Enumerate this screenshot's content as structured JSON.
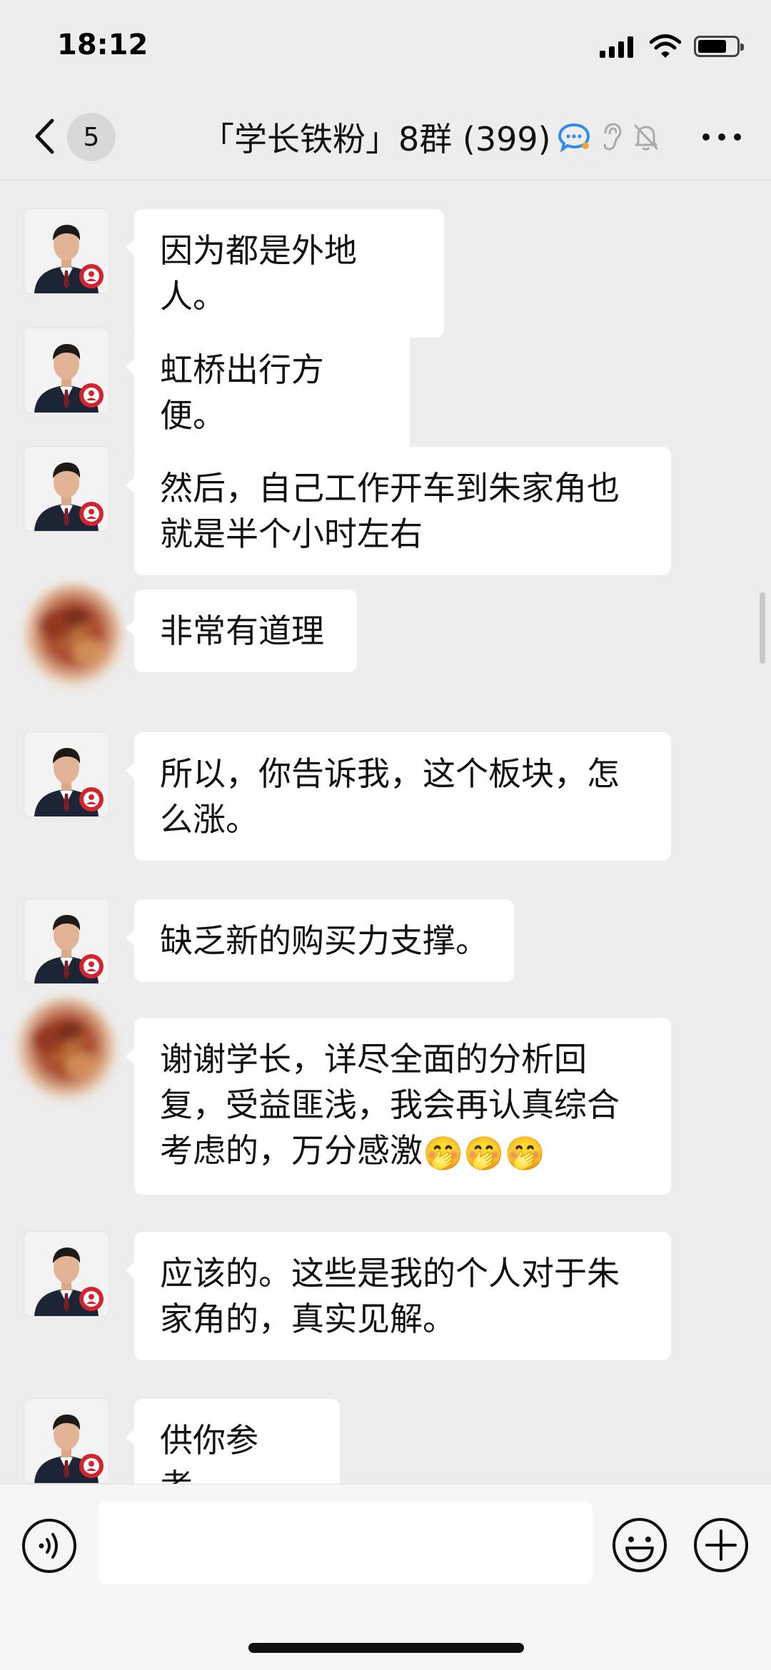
{
  "status_bar": {
    "time": "18:12",
    "icons": [
      "signal-icon",
      "wifi-icon",
      "battery-icon"
    ],
    "battery_level": 0.75
  },
  "header": {
    "unread_count": "5",
    "title": "「学长铁粉」8群 (399)",
    "icons": [
      "back-chevron-icon",
      "chat-bubble-icon",
      "ear-icon",
      "muted-bell-icon",
      "more-dots-icon"
    ]
  },
  "messages": [
    {
      "sender": "expert",
      "text": "因为都是外地人。"
    },
    {
      "sender": "expert",
      "text": "虹桥出行方便。"
    },
    {
      "sender": "expert",
      "text": "然后，自己工作开车到朱家角也就是半个小时左右"
    },
    {
      "sender": "member",
      "text": "非常有道理"
    },
    {
      "sender": "expert",
      "text": "所以，你告诉我，这个板块，怎么涨。"
    },
    {
      "sender": "expert",
      "text": "缺乏新的购买力支撑。"
    },
    {
      "sender": "member",
      "text": "谢谢学长，详尽全面的分析回复，受益匪浅，我会再认真综合考虑的，万分感激",
      "emoji": "🤭🤭🤭"
    },
    {
      "sender": "expert",
      "text": "应该的。这些是我的个人对于朱家角的，真实见解。"
    },
    {
      "sender": "expert",
      "text": "供你参考。"
    }
  ],
  "input_bar": {
    "placeholder": "",
    "icons": [
      "voice-icon",
      "emoji-icon",
      "plus-icon"
    ]
  },
  "colors": {
    "background": "#ededed",
    "bubble": "#ffffff",
    "accent_blue": "#2f8cf0"
  }
}
